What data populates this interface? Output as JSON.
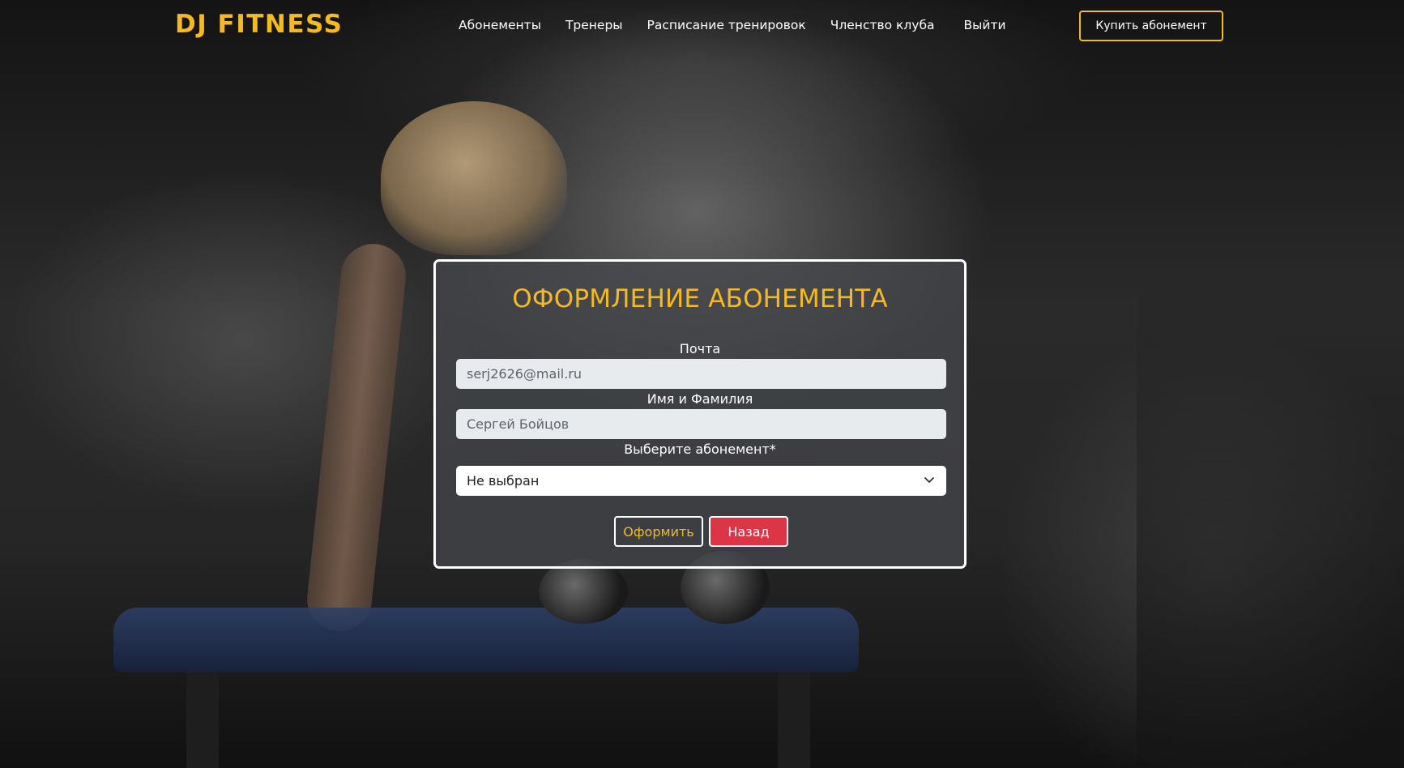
{
  "brand": "DJ FITNESS",
  "nav": {
    "items": [
      "Абонементы",
      "Тренеры",
      "Расписание тренировок",
      "Членство клуба",
      "Выйти"
    ],
    "cta": "Купить абонемент"
  },
  "form": {
    "title": "ОФОРМЛЕНИЕ АБОНЕМЕНТА",
    "email_label": "Почта",
    "email_value": "serj2626@mail.ru",
    "name_label": "Имя и Фамилия",
    "name_value": "Сергей Бойцов",
    "plan_label": "Выберите абонемент*",
    "plan_selected": "Не выбран",
    "submit_label": "Оформить",
    "back_label": "Назад"
  },
  "colors": {
    "accent": "#f5b921",
    "danger": "#dc3545"
  },
  "icons": {
    "select_arrow": "chevron-down-icon"
  }
}
